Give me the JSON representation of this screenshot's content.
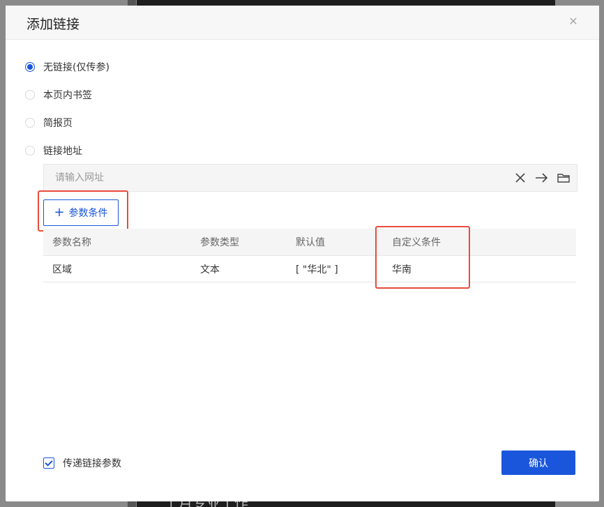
{
  "dialog": {
    "title": "添加链接",
    "close_icon": "close-icon"
  },
  "link_options": [
    {
      "label": "无链接(仅传参)",
      "checked": true
    },
    {
      "label": "本页内书签",
      "checked": false
    },
    {
      "label": "简报页",
      "checked": false
    },
    {
      "label": "链接地址",
      "checked": false
    }
  ],
  "url": {
    "placeholder": "请输入网址",
    "value": "",
    "icons": [
      "clear-icon",
      "go-arrow-icon",
      "folder-icon"
    ]
  },
  "add_param": {
    "label": "参数条件",
    "icon": "plus-icon"
  },
  "param_table": {
    "headers": [
      "参数名称",
      "参数类型",
      "默认值",
      "自定义条件"
    ],
    "rows": [
      [
        "区域",
        "文本",
        "[ \"华北\" ]",
        "华南"
      ]
    ]
  },
  "pass_params": {
    "label": "传递链接参数",
    "checked": true
  },
  "confirm": {
    "label": "确认"
  },
  "background_text": "上月专业工作",
  "colors": {
    "accent": "#1a56db",
    "highlight": "#e74c3c"
  }
}
